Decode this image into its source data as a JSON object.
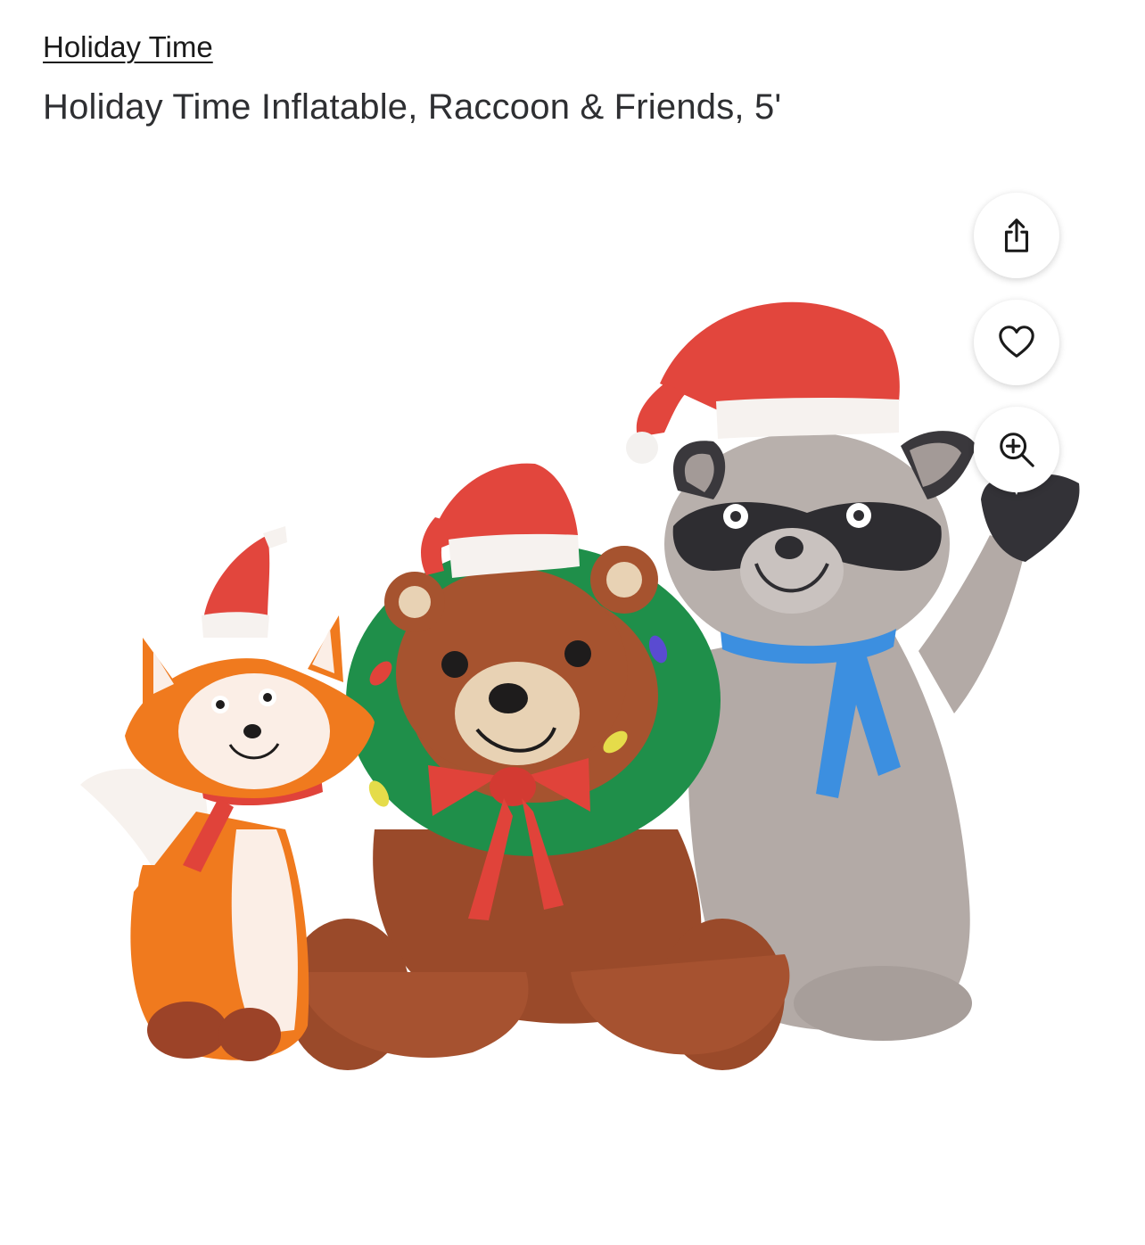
{
  "product": {
    "brand": "Holiday Time",
    "title": "Holiday Time Inflatable, Raccoon & Friends, 5'"
  },
  "image": {
    "characters": [
      "fox",
      "bear",
      "raccoon"
    ]
  },
  "actions": [
    {
      "name": "share-button",
      "icon": "share-icon"
    },
    {
      "name": "favorite-button",
      "icon": "heart-icon"
    },
    {
      "name": "zoom-button",
      "icon": "zoom-in-icon"
    }
  ],
  "colors": {
    "text": "#2e2f32",
    "hat_red": "#e2463d",
    "fox_orange": "#f07a1e",
    "bear_brown": "#9a4a2a",
    "raccoon_gray": "#b3aaa6",
    "scarf_blue": "#3c8fe0",
    "wreath_green": "#1f8f4a"
  }
}
